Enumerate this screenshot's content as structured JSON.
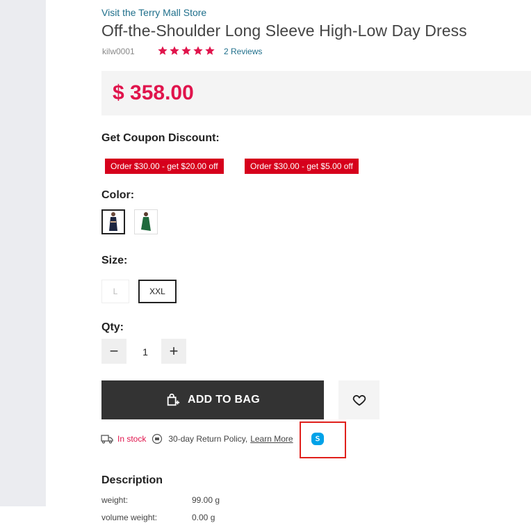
{
  "store": {
    "link_text": "Visit the Terry Mall Store"
  },
  "product": {
    "title": "Off-the-Shoulder Long Sleeve High-Low Day Dress",
    "sku": "kilw0001",
    "rating": 5,
    "reviews_text": "2 Reviews",
    "price": "$ 358.00"
  },
  "coupon": {
    "label": "Get Coupon Discount:",
    "items": [
      "Order $30.00 - get $20.00 off",
      "Order $30.00 - get $5.00 off"
    ]
  },
  "color": {
    "label": "Color:",
    "options": [
      "navy",
      "green"
    ],
    "selected": "navy"
  },
  "size": {
    "label": "Size:",
    "options": [
      "L",
      "XXL"
    ],
    "selected": "XXL"
  },
  "qty": {
    "label": "Qty:",
    "value": "1",
    "minus": "−",
    "plus": "+"
  },
  "actions": {
    "add_to_bag": "ADD TO BAG",
    "wishlist_icon": "heart-icon"
  },
  "shipping": {
    "stock": "In stock",
    "return_policy": "30-day Return Policy,",
    "learn_more": "Learn More",
    "skype_icon": "skype-icon"
  },
  "description": {
    "title": "Description",
    "rows": [
      {
        "key": "weight:",
        "value": "99.00 g"
      },
      {
        "key": "volume weight:",
        "value": "0.00 g"
      }
    ]
  },
  "colors": {
    "price": "#e0144c",
    "coupon": "#d6001c",
    "link": "#1f6f8b",
    "highlight": "#e0201c"
  }
}
